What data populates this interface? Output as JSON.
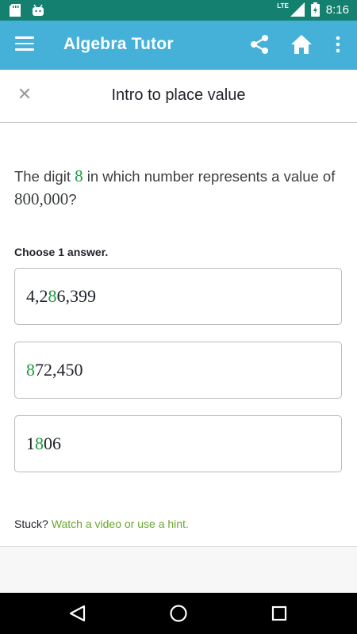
{
  "status_bar": {
    "time": "8:16",
    "network": "LTE",
    "icons": [
      "sd-card-icon",
      "android-icon",
      "signal-icon",
      "battery-icon"
    ],
    "background": "#14806f"
  },
  "app_bar": {
    "title": "Algebra Tutor",
    "icons": [
      "menu-icon",
      "share-icon",
      "home-icon",
      "more-vert-icon"
    ],
    "background": "#45b1d8"
  },
  "exercise": {
    "title": "Intro to place value",
    "close_icon": "close-icon"
  },
  "question": {
    "prefix": "The digit ",
    "digit": "8",
    "middle": " in which number represents a value of ",
    "value": "800,000",
    "suffix": "?"
  },
  "choose_label": "Choose 1 answer.",
  "choices": [
    {
      "before": "4,2",
      "highlight": "8",
      "after": "6,399"
    },
    {
      "before": "",
      "highlight": "8",
      "after": "72,450"
    },
    {
      "before": "1",
      "highlight": "8",
      "after": "06"
    }
  ],
  "help": {
    "stuck_label": "Stuck?",
    "hint_link": "Watch a video or use a hint."
  },
  "colors": {
    "highlight_green": "#1a9c3c",
    "link_green": "#6aa62c"
  },
  "nav_bar": {
    "icons": [
      "back-icon",
      "home-circle-icon",
      "recent-apps-icon"
    ]
  }
}
